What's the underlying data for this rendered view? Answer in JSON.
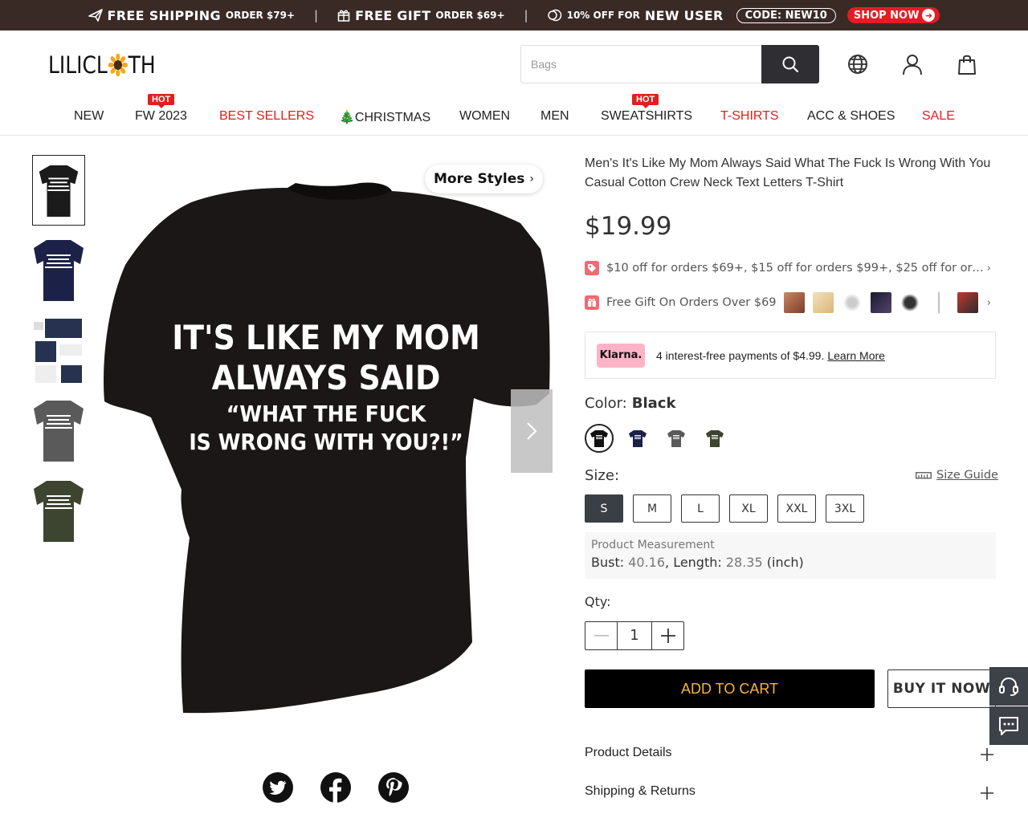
{
  "promo": {
    "shipping_big": "FREE SHIPPING",
    "shipping_small": "ORDER $79+",
    "gift_big": "FREE GIFT",
    "gift_small": "ORDER $69+",
    "off_small_a": "10% OFF FOR",
    "off_big": "NEW USER",
    "code": "CODE: NEW10",
    "shop_now": "SHOP NOW",
    "separator": "|"
  },
  "header": {
    "logo_pre": "LILICL",
    "logo_post": "TH",
    "search_placeholder": "Bags",
    "icons": [
      "search-icon",
      "globe-icon",
      "user-icon",
      "bag-icon"
    ]
  },
  "nav": {
    "items": [
      {
        "label": "NEW",
        "red": false
      },
      {
        "label": "FW 2023",
        "red": false,
        "badge": "HOT"
      },
      {
        "label": "BEST SELLERS",
        "red": true
      },
      {
        "label": "🎄CHRISTMAS",
        "red": false
      },
      {
        "label": "WOMEN",
        "red": false
      },
      {
        "label": "MEN",
        "red": false
      },
      {
        "label": "SWEATSHIRTS",
        "red": false,
        "badge": "HOT"
      },
      {
        "label": "T-SHIRTS",
        "red": true
      },
      {
        "label": "ACC & SHOES",
        "red": false
      },
      {
        "label": "SALE",
        "red": true
      }
    ]
  },
  "gallery": {
    "more_styles": "More Styles",
    "shirt_text": [
      "IT'S LIKE MY MOM",
      "ALWAYS SAID",
      "“WHAT THE FUCK",
      "IS WRONG WITH YOU?!”"
    ],
    "thumb_colors": [
      "#1b1b1b",
      "#1c2147",
      "#26324f",
      "#5a5a5a",
      "#3d4430"
    ]
  },
  "product": {
    "title": "Men's It's Like My Mom Always Said What The Fuck Is Wrong With You Casual Cotton Crew Neck Text Letters T-Shirt",
    "price": "$19.99",
    "discount_text": "$10 off for orders $69+, $15 off for orders $99+, $25 off for ord...",
    "gift_text": "Free Gift On Orders Over $69",
    "klarna_badge": "Klarna.",
    "klarna_text": "4 interest-free payments of $4.99.",
    "klarna_link": "Learn More",
    "color_label": "Color:",
    "color_value": "Black",
    "swatches": [
      "#111111",
      "#1c2147",
      "#5a5a5a",
      "#3d4430"
    ],
    "size_label": "Size:",
    "size_guide": "Size Guide",
    "sizes": [
      "S",
      "M",
      "L",
      "XL",
      "XXL",
      "3XL"
    ],
    "selected_size": "S",
    "measure_title": "Product Measurement",
    "bust_label": "Bust: ",
    "bust_value": "40.16",
    "length_label": ", Length: ",
    "length_value": "28.35",
    "unit": " (inch)",
    "qty_label": "Qty:",
    "qty_value": "1",
    "add_to_cart": "ADD TO CART",
    "buy_now": "BUY IT NOW",
    "product_details": "Product Details",
    "shipping_returns": "Shipping & Returns"
  },
  "colors": {
    "promo_bg": "#3a2a26",
    "accent_red": "#e0201e",
    "cart_text": "#f7b33d",
    "klarna_pink": "#ffb3c7"
  }
}
